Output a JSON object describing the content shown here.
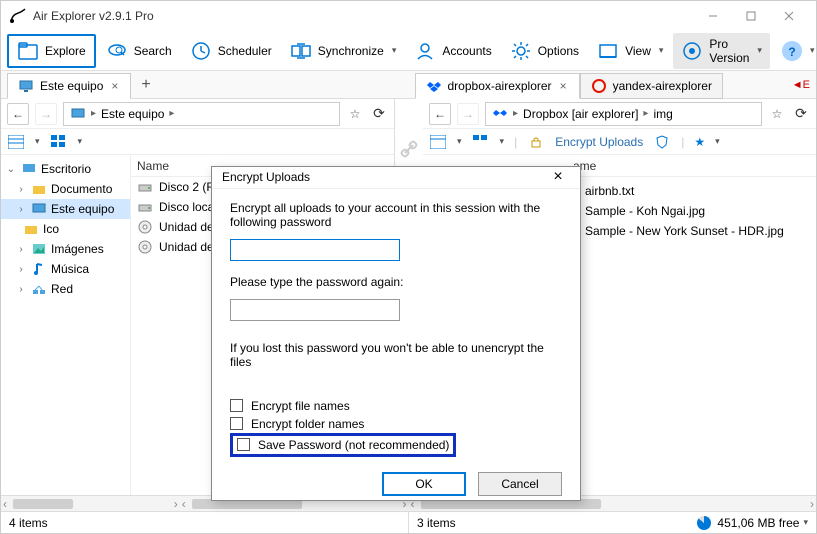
{
  "window": {
    "title": "Air Explorer v2.9.1 Pro"
  },
  "toolbar": {
    "explore": "Explore",
    "search": "Search",
    "scheduler": "Scheduler",
    "synchronize": "Synchronize",
    "accounts": "Accounts",
    "options": "Options",
    "view": "View",
    "pro": "Pro Version"
  },
  "tabs": {
    "left": "Este equipo",
    "right1": "dropbox-airexplorer",
    "right2": "yandex-airexplorer"
  },
  "left": {
    "crumb1": "Este equipo",
    "col_name": "Name",
    "tree": {
      "root": "Escritorio",
      "documents": "Documento",
      "este": "Este equipo",
      "ico": "Ico",
      "imagenes": "Imágenes",
      "musica": "Música",
      "red": "Red"
    },
    "files": {
      "disco2": "Disco 2 (F:)",
      "discoloc": "Disco loca",
      "unidad1": "Unidad de",
      "unidad2": "Unidad de"
    },
    "status": "4 items"
  },
  "right": {
    "crumb_root": "Dropbox [air explorer]",
    "crumb_sub": "img",
    "encrypt_label": "Encrypt Uploads",
    "col_name": "ame",
    "files": {
      "airbnb": "airbnb.txt",
      "koh": "Sample - Koh Ngai.jpg",
      "ny": "Sample - New York Sunset - HDR.jpg"
    },
    "status_items": "3 items",
    "status_free": "451,06 MB free"
  },
  "dialog": {
    "title": "Encrypt Uploads",
    "intro": "Encrypt all uploads to your account in this session with the following password",
    "again": "Please type the password again:",
    "warn": "If you lost this password you won't be able to unencrypt the files",
    "chk_files": "Encrypt file names",
    "chk_folders": "Encrypt folder names",
    "chk_save": "Save Password (not recommended)",
    "ok": "OK",
    "cancel": "Cancel"
  }
}
